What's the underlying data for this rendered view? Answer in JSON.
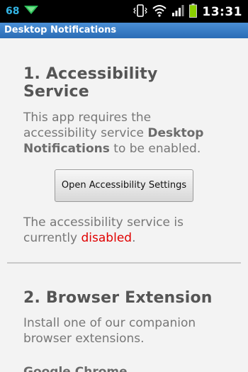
{
  "status_bar": {
    "notification_count": "68",
    "time": "13:31",
    "colors": {
      "notification": "#33b5e5",
      "battery": "#8bd000"
    },
    "icons": [
      "notification-arrow-icon",
      "vibrate-icon",
      "wifi-icon",
      "signal-icon",
      "battery-icon"
    ]
  },
  "title_bar": {
    "title": "Desktop Notifications"
  },
  "section1": {
    "title": "1. Accessibility Service",
    "description_pre": "This app requires the accessibility service ",
    "description_bold": "Desktop Notifications",
    "description_post": " to be enabled.",
    "button_label": "Open Accessibility Settings",
    "status_pre": "The accessibility service is currently ",
    "status_value": "disabled",
    "status_post": ".",
    "status_color": "#e00000"
  },
  "section2": {
    "title": "2. Browser Extension",
    "description": "Install one of our companion browser extensions.",
    "subheading": "Google Chrome"
  }
}
